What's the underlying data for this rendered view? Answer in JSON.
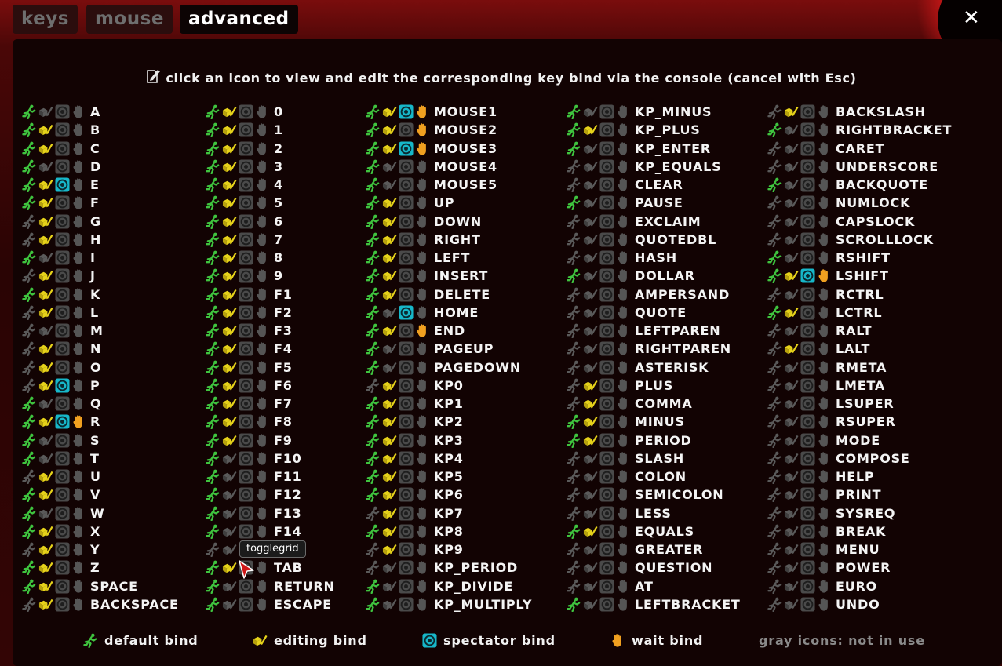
{
  "tabs": [
    {
      "label": "keys",
      "active": false
    },
    {
      "label": "mouse",
      "active": false
    },
    {
      "label": "advanced",
      "active": true
    }
  ],
  "close_label": "✕",
  "hint": "click an icon to view and edit the corresponding key bind via the console (cancel with Esc)",
  "tooltip": "togglegrid",
  "colors": {
    "default": "#3fc43f",
    "editing": "#e6d21a",
    "spectator": "#17b7c9",
    "wait": "#f0a020",
    "gray": "#5a5a5a"
  },
  "columns": [
    {
      "keys": [
        {
          "k": "A",
          "b": "1000"
        },
        {
          "k": "B",
          "b": "1100"
        },
        {
          "k": "C",
          "b": "1100"
        },
        {
          "k": "D",
          "b": "1000"
        },
        {
          "k": "E",
          "b": "1110"
        },
        {
          "k": "F",
          "b": "1100"
        },
        {
          "k": "G",
          "b": "0100"
        },
        {
          "k": "H",
          "b": "0100"
        },
        {
          "k": "I",
          "b": "1000"
        },
        {
          "k": "J",
          "b": "0100"
        },
        {
          "k": "K",
          "b": "1100"
        },
        {
          "k": "L",
          "b": "0100"
        },
        {
          "k": "M",
          "b": "0000"
        },
        {
          "k": "N",
          "b": "0100"
        },
        {
          "k": "O",
          "b": "0100"
        },
        {
          "k": "P",
          "b": "0110"
        },
        {
          "k": "Q",
          "b": "1000"
        },
        {
          "k": "R",
          "b": "1111"
        },
        {
          "k": "S",
          "b": "1000"
        },
        {
          "k": "T",
          "b": "1000"
        },
        {
          "k": "U",
          "b": "0100"
        },
        {
          "k": "V",
          "b": "1100"
        },
        {
          "k": "W",
          "b": "1000"
        },
        {
          "k": "X",
          "b": "1100"
        },
        {
          "k": "Y",
          "b": "0100"
        },
        {
          "k": "Z",
          "b": "1100"
        },
        {
          "k": "SPACE",
          "b": "1100"
        },
        {
          "k": "BACKSPACE",
          "b": "0100"
        }
      ]
    },
    {
      "keys": [
        {
          "k": "0",
          "b": "1100"
        },
        {
          "k": "1",
          "b": "1100"
        },
        {
          "k": "2",
          "b": "1100"
        },
        {
          "k": "3",
          "b": "1100"
        },
        {
          "k": "4",
          "b": "1100"
        },
        {
          "k": "5",
          "b": "1100"
        },
        {
          "k": "6",
          "b": "1100"
        },
        {
          "k": "7",
          "b": "1100"
        },
        {
          "k": "8",
          "b": "1100"
        },
        {
          "k": "9",
          "b": "1100"
        },
        {
          "k": "F1",
          "b": "1100"
        },
        {
          "k": "F2",
          "b": "1100"
        },
        {
          "k": "F3",
          "b": "1100"
        },
        {
          "k": "F4",
          "b": "1100"
        },
        {
          "k": "F5",
          "b": "1100"
        },
        {
          "k": "F6",
          "b": "1100"
        },
        {
          "k": "F7",
          "b": "1100"
        },
        {
          "k": "F8",
          "b": "1100"
        },
        {
          "k": "F9",
          "b": "1100"
        },
        {
          "k": "F10",
          "b": "1000"
        },
        {
          "k": "F11",
          "b": "1000"
        },
        {
          "k": "F12",
          "b": "1000"
        },
        {
          "k": "F13",
          "b": "1000"
        },
        {
          "k": "F14",
          "b": "1000"
        },
        {
          "k": "",
          "b": "0000"
        },
        {
          "k": "TAB",
          "b": "1100"
        },
        {
          "k": "RETURN",
          "b": "1000"
        },
        {
          "k": "ESCAPE",
          "b": "1000"
        }
      ]
    },
    {
      "keys": [
        {
          "k": "MOUSE1",
          "b": "1111"
        },
        {
          "k": "MOUSE2",
          "b": "1101"
        },
        {
          "k": "MOUSE3",
          "b": "1111"
        },
        {
          "k": "MOUSE4",
          "b": "1000"
        },
        {
          "k": "MOUSE5",
          "b": "1000"
        },
        {
          "k": "UP",
          "b": "1100"
        },
        {
          "k": "DOWN",
          "b": "1100"
        },
        {
          "k": "RIGHT",
          "b": "1100"
        },
        {
          "k": "LEFT",
          "b": "1100"
        },
        {
          "k": "INSERT",
          "b": "1100"
        },
        {
          "k": "DELETE",
          "b": "1100"
        },
        {
          "k": "HOME",
          "b": "1010"
        },
        {
          "k": "END",
          "b": "1101"
        },
        {
          "k": "PAGEUP",
          "b": "1000"
        },
        {
          "k": "PAGEDOWN",
          "b": "1000"
        },
        {
          "k": "KP0",
          "b": "0100"
        },
        {
          "k": "KP1",
          "b": "1100"
        },
        {
          "k": "KP2",
          "b": "1100"
        },
        {
          "k": "KP3",
          "b": "1100"
        },
        {
          "k": "KP4",
          "b": "1100"
        },
        {
          "k": "KP5",
          "b": "1100"
        },
        {
          "k": "KP6",
          "b": "1100"
        },
        {
          "k": "KP7",
          "b": "0100"
        },
        {
          "k": "KP8",
          "b": "1100"
        },
        {
          "k": "KP9",
          "b": "0100"
        },
        {
          "k": "KP_PERIOD",
          "b": "0000"
        },
        {
          "k": "KP_DIVIDE",
          "b": "1000"
        },
        {
          "k": "KP_MULTIPLY",
          "b": "1000"
        }
      ]
    },
    {
      "keys": [
        {
          "k": "KP_MINUS",
          "b": "1000"
        },
        {
          "k": "KP_PLUS",
          "b": "1100"
        },
        {
          "k": "KP_ENTER",
          "b": "1000"
        },
        {
          "k": "KP_EQUALS",
          "b": "0000"
        },
        {
          "k": "CLEAR",
          "b": "0000"
        },
        {
          "k": "PAUSE",
          "b": "1000"
        },
        {
          "k": "EXCLAIM",
          "b": "0000"
        },
        {
          "k": "QUOTEDBL",
          "b": "0000"
        },
        {
          "k": "HASH",
          "b": "0000"
        },
        {
          "k": "DOLLAR",
          "b": "1000"
        },
        {
          "k": "AMPERSAND",
          "b": "0000"
        },
        {
          "k": "QUOTE",
          "b": "0000"
        },
        {
          "k": "LEFTPAREN",
          "b": "0000"
        },
        {
          "k": "RIGHTPAREN",
          "b": "0000"
        },
        {
          "k": "ASTERISK",
          "b": "0000"
        },
        {
          "k": "PLUS",
          "b": "0100"
        },
        {
          "k": "COMMA",
          "b": "0100"
        },
        {
          "k": "MINUS",
          "b": "1100"
        },
        {
          "k": "PERIOD",
          "b": "1100"
        },
        {
          "k": "SLASH",
          "b": "0000"
        },
        {
          "k": "COLON",
          "b": "0000"
        },
        {
          "k": "SEMICOLON",
          "b": "0000"
        },
        {
          "k": "LESS",
          "b": "0000"
        },
        {
          "k": "EQUALS",
          "b": "1100"
        },
        {
          "k": "GREATER",
          "b": "0000"
        },
        {
          "k": "QUESTION",
          "b": "0000"
        },
        {
          "k": "AT",
          "b": "0000"
        },
        {
          "k": "LEFTBRACKET",
          "b": "1000"
        }
      ]
    },
    {
      "keys": [
        {
          "k": "BACKSLASH",
          "b": "0100"
        },
        {
          "k": "RIGHTBRACKET",
          "b": "1000"
        },
        {
          "k": "CARET",
          "b": "0000"
        },
        {
          "k": "UNDERSCORE",
          "b": "0000"
        },
        {
          "k": "BACKQUOTE",
          "b": "1000"
        },
        {
          "k": "NUMLOCK",
          "b": "0000"
        },
        {
          "k": "CAPSLOCK",
          "b": "0000"
        },
        {
          "k": "SCROLLLOCK",
          "b": "0000"
        },
        {
          "k": "RSHIFT",
          "b": "1000"
        },
        {
          "k": "LSHIFT",
          "b": "1111"
        },
        {
          "k": "RCTRL",
          "b": "0000"
        },
        {
          "k": "LCTRL",
          "b": "1100"
        },
        {
          "k": "RALT",
          "b": "0000"
        },
        {
          "k": "LALT",
          "b": "0100"
        },
        {
          "k": "RMETA",
          "b": "0000"
        },
        {
          "k": "LMETA",
          "b": "0000"
        },
        {
          "k": "LSUPER",
          "b": "0000"
        },
        {
          "k": "RSUPER",
          "b": "0000"
        },
        {
          "k": "MODE",
          "b": "0000"
        },
        {
          "k": "COMPOSE",
          "b": "0000"
        },
        {
          "k": "HELP",
          "b": "0000"
        },
        {
          "k": "PRINT",
          "b": "0000"
        },
        {
          "k": "SYSREQ",
          "b": "0000"
        },
        {
          "k": "BREAK",
          "b": "0000"
        },
        {
          "k": "MENU",
          "b": "0000"
        },
        {
          "k": "POWER",
          "b": "0000"
        },
        {
          "k": "EURO",
          "b": "0000"
        },
        {
          "k": "UNDO",
          "b": "0000"
        }
      ]
    }
  ],
  "legend": {
    "default": "default bind",
    "editing": "editing bind",
    "spectator": "spectator bind",
    "wait": "wait bind",
    "gray": "gray icons: not in use"
  }
}
